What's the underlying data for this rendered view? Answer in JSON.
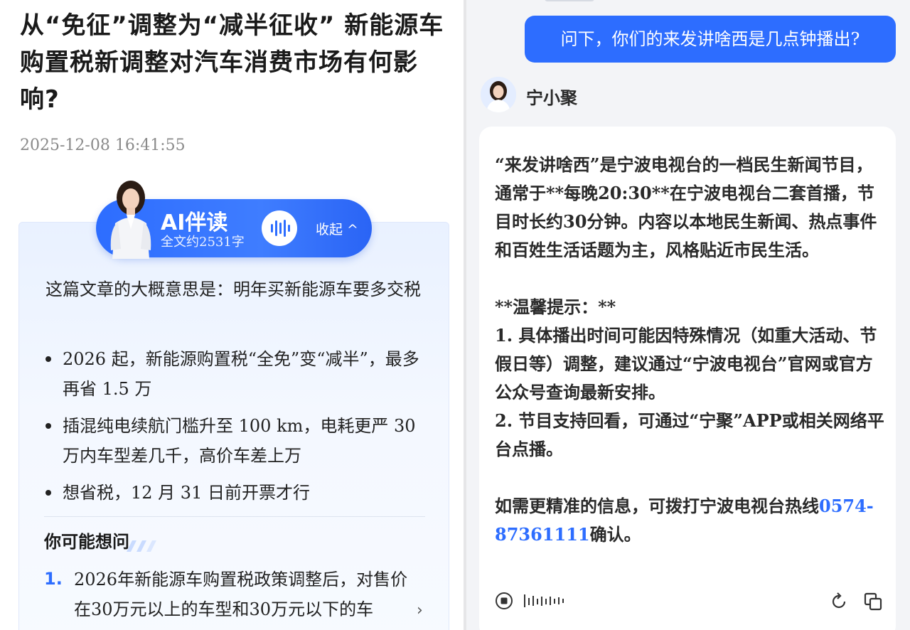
{
  "article": {
    "title": "从“免征”调整为“减半征收” 新能源车购置税新调整对汽车消费市场有何影响?",
    "date": "2025-12-08 16:41:55"
  },
  "ai_reader": {
    "name": "AI伴读",
    "subtitle": "全文约2531字",
    "collapse_label": "收起 ^",
    "summary": "这篇文章的大概意思是：明年买新能源车要多交税",
    "bullets": [
      "2026 起，新能源购置税“全免”变“减半”，最多再省 1.5 万",
      "插混纯电续航门槛升至 100 km，电耗更严 30 万内车型差几千，高价车差上万",
      "想省税，12 月 31 日前开票才行"
    ],
    "ask_title": "你可能想问",
    "questions": [
      {
        "num": "1.",
        "text": "2026年新能源车购置税政策调整后，对售价在30万元以上的车型和30万元以下的车"
      }
    ],
    "chevron": "›"
  },
  "chat": {
    "user_message": "问下，你们的来发讲啥西是几点钟播出?",
    "bot_name": "宁小聚",
    "bot_reply_main": "“来发讲啥西”是宁波电视台的一档民生新闻节目，通常于**每晚20:30**在宁波电视台二套首播，节目时长约30分钟。内容以本地民生新闻、热点事件和百姓生活话题为主，风格贴近市民生活。\n\n**温馨提示：**\n1. 具体播出时间可能因特殊情况（如重大活动、节假日等）调整，建议通过“宁波电视台”官网或官方公众号查询最新安排。\n2. 节目支持回看，可通过“宁聚”APP或相关网络平台点播。\n\n如需更精准的信息，可拨打宁波电视台热线",
    "bot_phone": "0574-87361111",
    "bot_reply_end": "确认。"
  },
  "colors": {
    "accent": "#2d6dff",
    "user_bubble": "#2d6dff",
    "chat_bg": "#f3f4f7"
  },
  "icons": [
    "stop-icon",
    "voice-wave-icon",
    "refresh-icon",
    "copy-icon",
    "audio-wave-icon",
    "chevron-right-icon"
  ]
}
